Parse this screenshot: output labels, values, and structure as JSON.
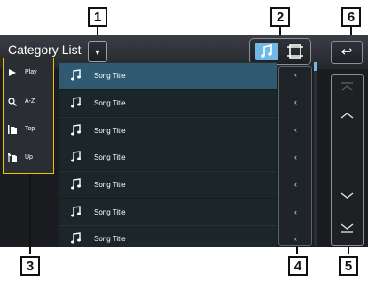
{
  "header": {
    "title": "Category List"
  },
  "left_panel": {
    "buttons": [
      {
        "label": "Play",
        "icon": "play-icon"
      },
      {
        "label": "A-Z",
        "icon": "search-icon"
      },
      {
        "label": "Top",
        "icon": "folder-top-icon"
      },
      {
        "label": "Up",
        "icon": "folder-up-icon"
      }
    ]
  },
  "list": {
    "items": [
      {
        "title": "Song Title",
        "icon": "music-note-icon"
      },
      {
        "title": "Song Title",
        "icon": "music-note-icon"
      },
      {
        "title": "Song Title",
        "icon": "music-note-icon"
      },
      {
        "title": "Song Title",
        "icon": "music-note-icon"
      },
      {
        "title": "Song Title",
        "icon": "music-note-icon"
      },
      {
        "title": "Song Title",
        "icon": "music-note-icon"
      },
      {
        "title": "Song Title",
        "icon": "music-note-icon"
      }
    ],
    "chevron": "‹"
  },
  "callouts": {
    "c1": "1",
    "c2": "2",
    "c3": "3",
    "c4": "4",
    "c5": "5",
    "c6": "6"
  },
  "colors": {
    "accent": "#6fb9e8",
    "screen_bg": "#1a1c20",
    "selected_row": "#2f5a72"
  }
}
